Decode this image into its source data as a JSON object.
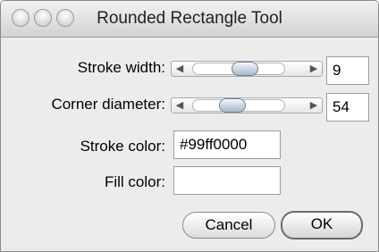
{
  "window": {
    "title": "Rounded Rectangle Tool"
  },
  "stroke_width": {
    "label": "Stroke width:",
    "value": "9"
  },
  "corner_diameter": {
    "label": "Corner diameter:",
    "value": "54"
  },
  "stroke_color": {
    "label": "Stroke color:",
    "value": "#99ff0000"
  },
  "fill_color": {
    "label": "Fill color:",
    "value": ""
  },
  "buttons": {
    "cancel": "Cancel",
    "ok": "OK"
  },
  "icons": {
    "slider_left": "arrow-left-icon",
    "slider_right": "arrow-right-icon"
  }
}
